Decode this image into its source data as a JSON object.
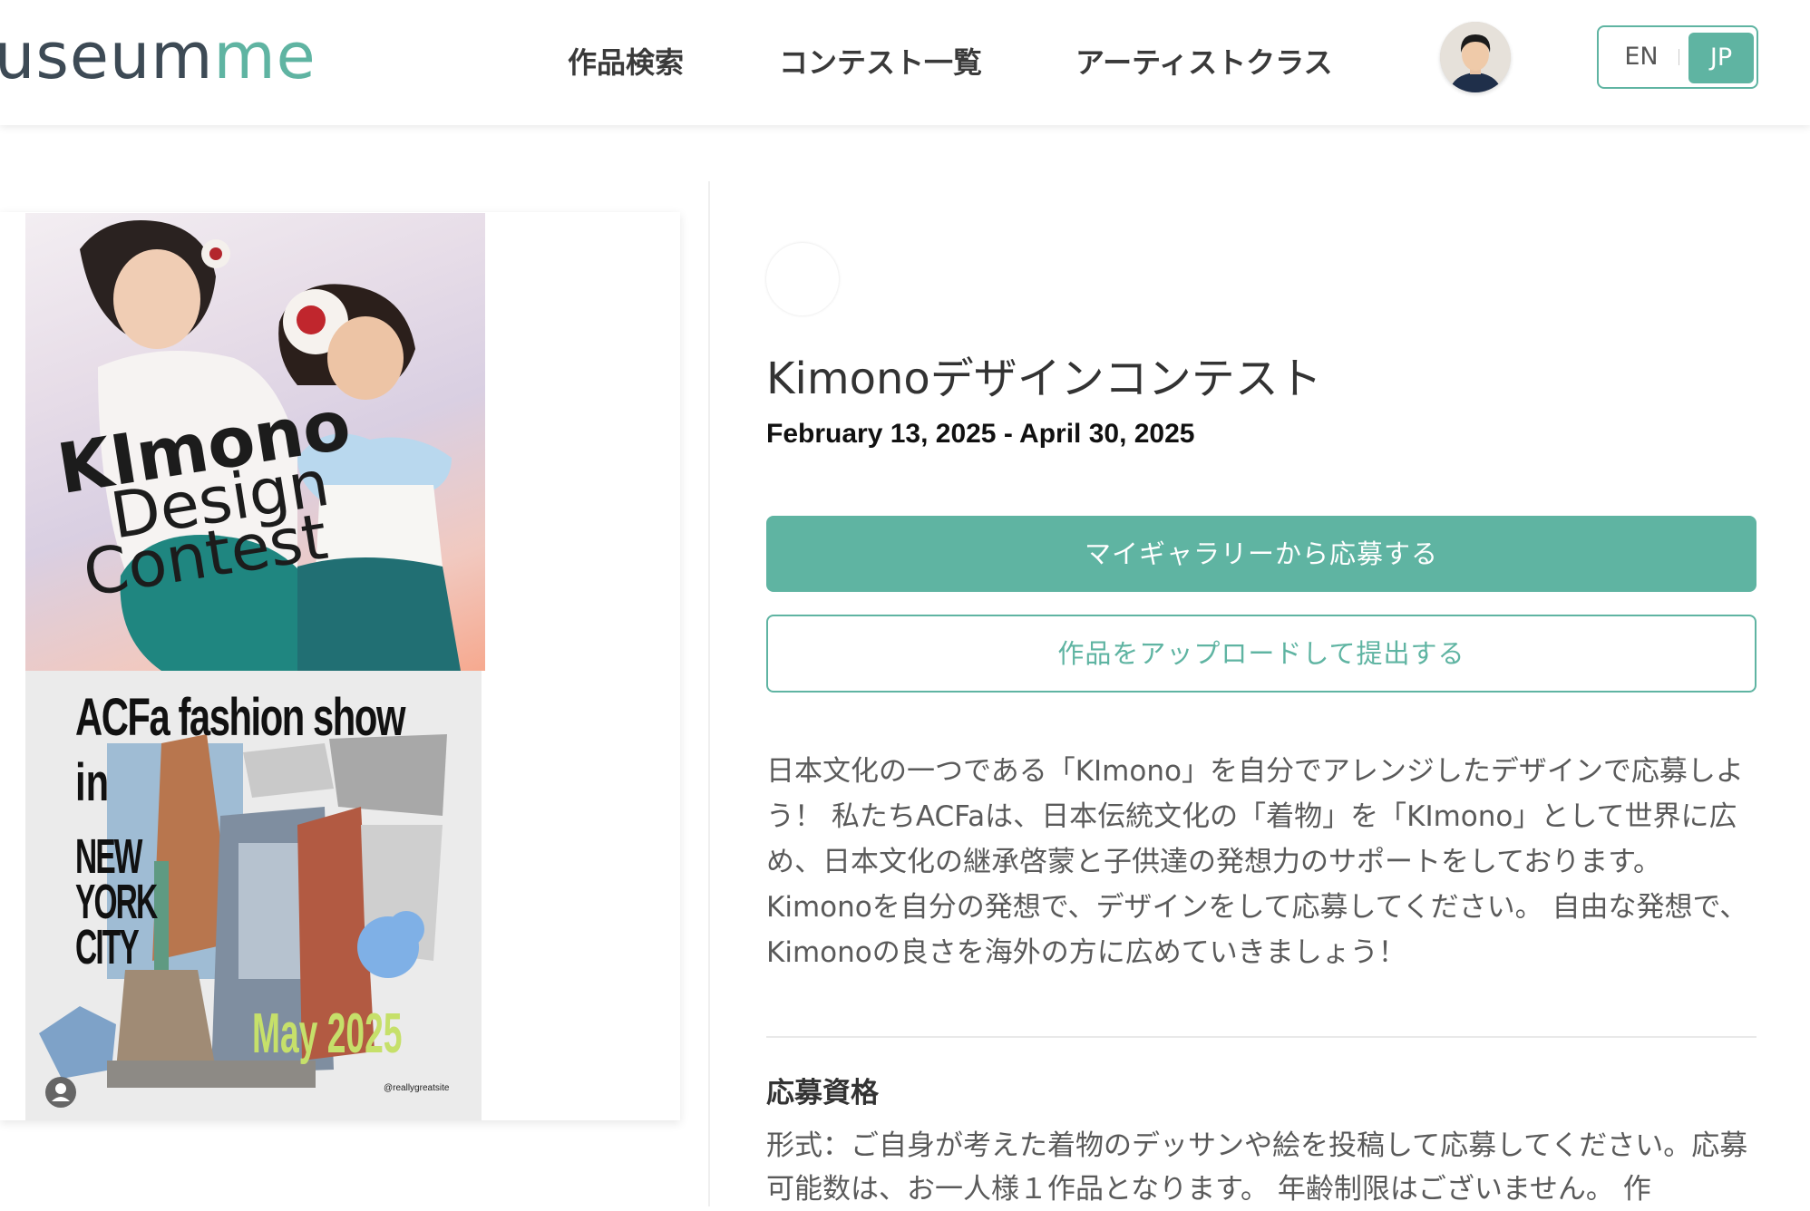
{
  "header": {
    "logo_dark": "useum",
    "logo_teal": "me",
    "nav": [
      {
        "label": "作品検索"
      },
      {
        "label": "コンテスト一覧"
      },
      {
        "label": "アーティストクラス"
      }
    ],
    "lang": {
      "en": "EN",
      "jp": "JP",
      "active": "JP"
    }
  },
  "poster": {
    "kimono_line1": "KImono",
    "kimono_line2": "Design",
    "kimono_line3": "Contest",
    "title": "ACFa fashion show",
    "in": "in",
    "city_line1": "NEW",
    "city_line2": "YORK",
    "city_line3": "CITY",
    "date": "May 2025",
    "site": "@reallygreatsite"
  },
  "contest": {
    "title": "Kimonoデザインコンテスト",
    "dates": "February 13, 2025 - April 30, 2025",
    "apply_gallery": "マイギャラリーから応募する",
    "apply_upload": "作品をアップロードして提出する",
    "description": "日本文化の一つである「KImono」を自分でアレンジしたデザインで応募しよう！ 私たちACFaは、日本伝統文化の「着物」を「KImono」として世界に広め、日本文化の継承啓蒙と子供達の発想力のサポートをしております。 Kimonoを自分の発想で、デザインをして応募してください。 自由な発想で、Kimonoの良さを海外の方に広めていきましょう！",
    "eligibility_heading": "応募資格",
    "eligibility_body": "形式：ご自身が考えた着物のデッサンや絵を投稿して応募してください。応募可能数は、お一人様１作品となります。 年齢制限はございません。 作"
  },
  "colors": {
    "accent": "#5fb4a2",
    "text": "#333333",
    "muted": "#5a5a5a"
  }
}
